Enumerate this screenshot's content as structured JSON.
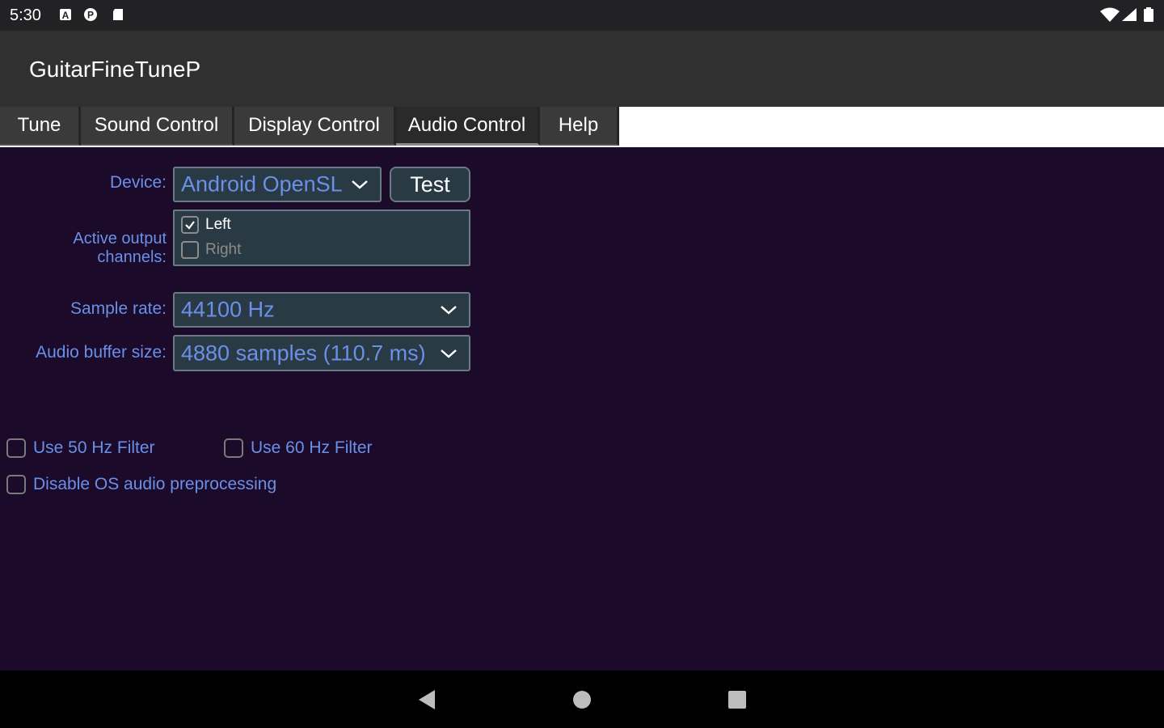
{
  "status_bar": {
    "time": "5:30",
    "icons": [
      "a-icon",
      "p-icon",
      "sd-card-icon",
      "wifi-icon",
      "signal-icon",
      "battery-icon"
    ]
  },
  "app": {
    "title": "GuitarFineTuneP"
  },
  "tabs": [
    {
      "label": "Tune",
      "active": false
    },
    {
      "label": "Sound Control",
      "active": false
    },
    {
      "label": "Display Control",
      "active": false
    },
    {
      "label": "Audio Control",
      "active": true
    },
    {
      "label": "Help",
      "active": false
    }
  ],
  "audio": {
    "device_label": "Device:",
    "device_value": "Android OpenSL",
    "test_label": "Test",
    "channels_label": "Active output channels:",
    "channels": [
      {
        "label": "Left",
        "checked": true
      },
      {
        "label": "Right",
        "checked": false
      }
    ],
    "sample_rate_label": "Sample rate:",
    "sample_rate_value": "44100 Hz",
    "buffer_label": "Audio buffer size:",
    "buffer_value": "4880 samples (110.7 ms)",
    "options": [
      {
        "label": "Use 50 Hz Filter",
        "checked": false
      },
      {
        "label": "Use 60 Hz Filter",
        "checked": false
      },
      {
        "label": "Disable OS audio preprocessing",
        "checked": false
      }
    ]
  },
  "colors": {
    "content_bg": "#1c0a2a",
    "label_blue": "#6a90e8",
    "field_bg": "#2a3a44",
    "app_bar": "#303030"
  }
}
